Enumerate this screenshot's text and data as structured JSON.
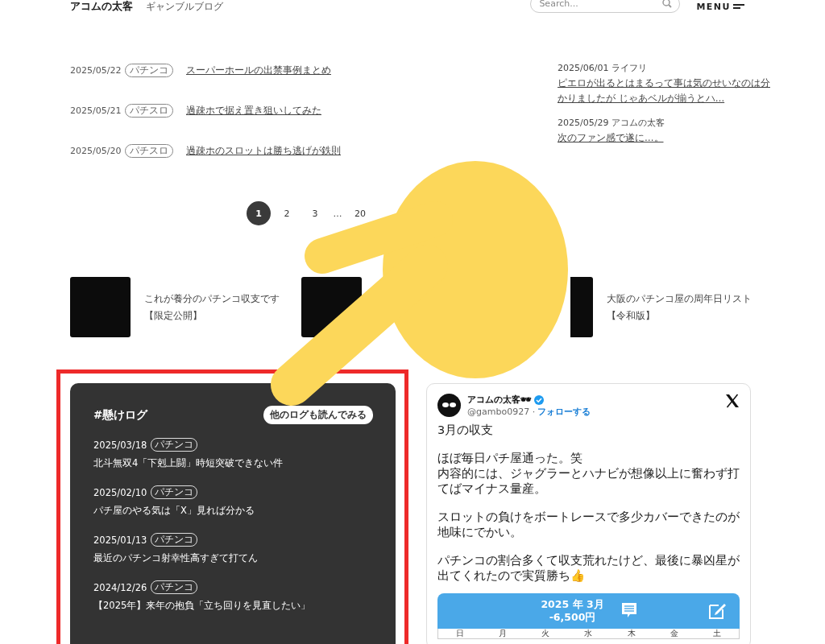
{
  "header": {
    "logo": "アコムの太客",
    "tagline": "ギャンブルブログ",
    "search": {
      "placeholder": "Search..."
    },
    "menu": "MENU"
  },
  "posts": [
    {
      "date": "2025/05/22",
      "tag": "パチンコ",
      "title": "スーパーホールの出禁事例まとめ"
    },
    {
      "date": "2025/05/21",
      "tag": "パチスロ",
      "title": "過疎ホで据え置き狙いしてみた"
    },
    {
      "date": "2025/05/20",
      "tag": "パチスロ",
      "title": "過疎ホのスロットは勝ち逃げが鉄則"
    }
  ],
  "recent": [
    {
      "date": "2025/06/01",
      "category": "ライフリ",
      "title": "ピエロが出るとはまるって事は気のせいなのは分かりましたが じゃあベルが揃うとハ…"
    },
    {
      "date": "2025/05/29",
      "category": "アコムの太客",
      "title": "次のファン感で遂に…。"
    }
  ],
  "pagination": [
    {
      "kind": "page",
      "label": "1",
      "selected": true
    },
    {
      "kind": "page",
      "label": "2",
      "selected": false
    },
    {
      "kind": "page",
      "label": "3",
      "selected": false
    },
    {
      "kind": "gap",
      "label": "…"
    },
    {
      "kind": "page",
      "label": "20",
      "selected": false
    }
  ],
  "related": [
    {
      "kind": "post",
      "title_lines": [
        "これが養分のパチンコ収支です",
        "【限定公開】"
      ]
    },
    {
      "kind": "covered"
    },
    {
      "kind": "post",
      "title_lines": [
        "大阪のパチンコ屋の周年日リスト",
        "【令和版】"
      ]
    }
  ],
  "log_card": {
    "title": "#懸けログ",
    "button": "他のログも読んでみる",
    "entries": [
      {
        "date": "2025/03/18",
        "tag": "パチンコ",
        "title": "北斗無双4「下剋上闘」時短突破できない件"
      },
      {
        "date": "2025/02/10",
        "tag": "パチンコ",
        "title": "パチ屋のやる気は「X」見れば分かる"
      },
      {
        "date": "2025/01/13",
        "tag": "パチンコ",
        "title": "最近のパチンコ射幸性高すぎて打てん"
      },
      {
        "date": "2024/12/26",
        "tag": "パチンコ",
        "title": "【2025年】来年の抱負「立ち回りを見直したい」"
      }
    ]
  },
  "tweet": {
    "name": "アコムの太客🕶",
    "handle": "@gambo0927 ·",
    "follow": "フォローする",
    "body": [
      [
        "3月の収支"
      ],
      [
        "ほぼ毎日パチ屋通った。笑",
        "内容的には、ジャグラーとハナビが想像以上に奮わず打てばマイナス量産。"
      ],
      [
        "スロットの負けをボートレースで多少カバーできたのが地味にでかい。"
      ],
      [
        "パチンコの割合多くて収支荒れたけど、最後に暴凶星が出てくれたので実質勝ち👍"
      ]
    ],
    "calendar": {
      "month": "2025 年 3月",
      "total": "-6,500円",
      "weekdays": [
        "日",
        "月",
        "火",
        "水",
        "木",
        "金",
        "土"
      ]
    }
  }
}
